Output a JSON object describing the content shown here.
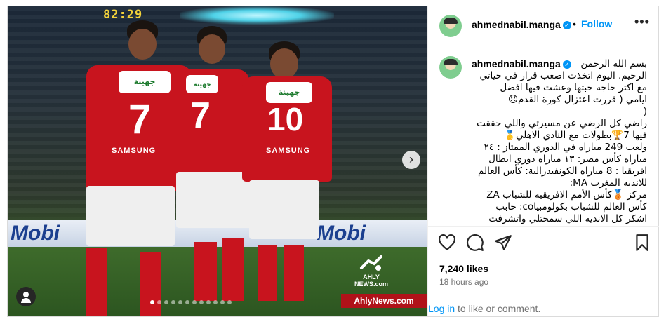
{
  "photo": {
    "scoreboard": "82:29",
    "board_text": "Mobi",
    "board_text_2": "Mobi",
    "sponsor": "جهينة",
    "shirt_numbers": [
      "7",
      "7",
      "10"
    ],
    "shirt_brand": "SAMSUNG",
    "watermark_logo": "AHLY NEWS.com",
    "watermark_url": "AhlyNews.com",
    "carousel": {
      "total": 12,
      "active_index": 0
    }
  },
  "post": {
    "username": "ahmednabil.manga",
    "follow_label": "Follow",
    "separator": "•",
    "more_label": "•••",
    "verified_glyph": "✓"
  },
  "caption": {
    "username": "ahmednabil.manga",
    "lines": [
      "بسم الله الرحمن",
      "الرحيم. اليوم اتخذت اصعب قرار في حياتي",
      "مع اكتر حاجه حبتها وعشت فيها افضل",
      "ايامي ( قررت اعتزال كورة القدم😞",
      "(",
      "راضي كل الرضي عن مسيرتي واللي حققت",
      "فيها 7🏆بطولات مع النادي الاهلي🥇",
      "ولعب 249 مباراه في الدوري الممتاز : ٢٤",
      "مباراه كأس مصر: ١٣ مباراه دوري ابطال",
      "افريقيا : 8 مباراه الكونفيدرالية: كأس العالم",
      "للانديه المغرب MA:",
      "مركز 🥉كأس الأمم الافريقيه للشباب ZA",
      "كأس العالم للشباب بكولومبياco: حابب",
      "اشكر كل الانديه اللي سمحتلي واتشرفت"
    ]
  },
  "actions": {
    "like": "heart-icon",
    "comment": "comment-icon",
    "share": "share-icon",
    "save": "bookmark-icon"
  },
  "likes_text": "7,240 likes",
  "time_text": "18 hours ago",
  "login": {
    "link": "Log in",
    "rest": " to like or comment."
  },
  "colors": {
    "accent": "#0095f6",
    "secondary_text": "#737373",
    "kit_red": "#c8141e"
  }
}
